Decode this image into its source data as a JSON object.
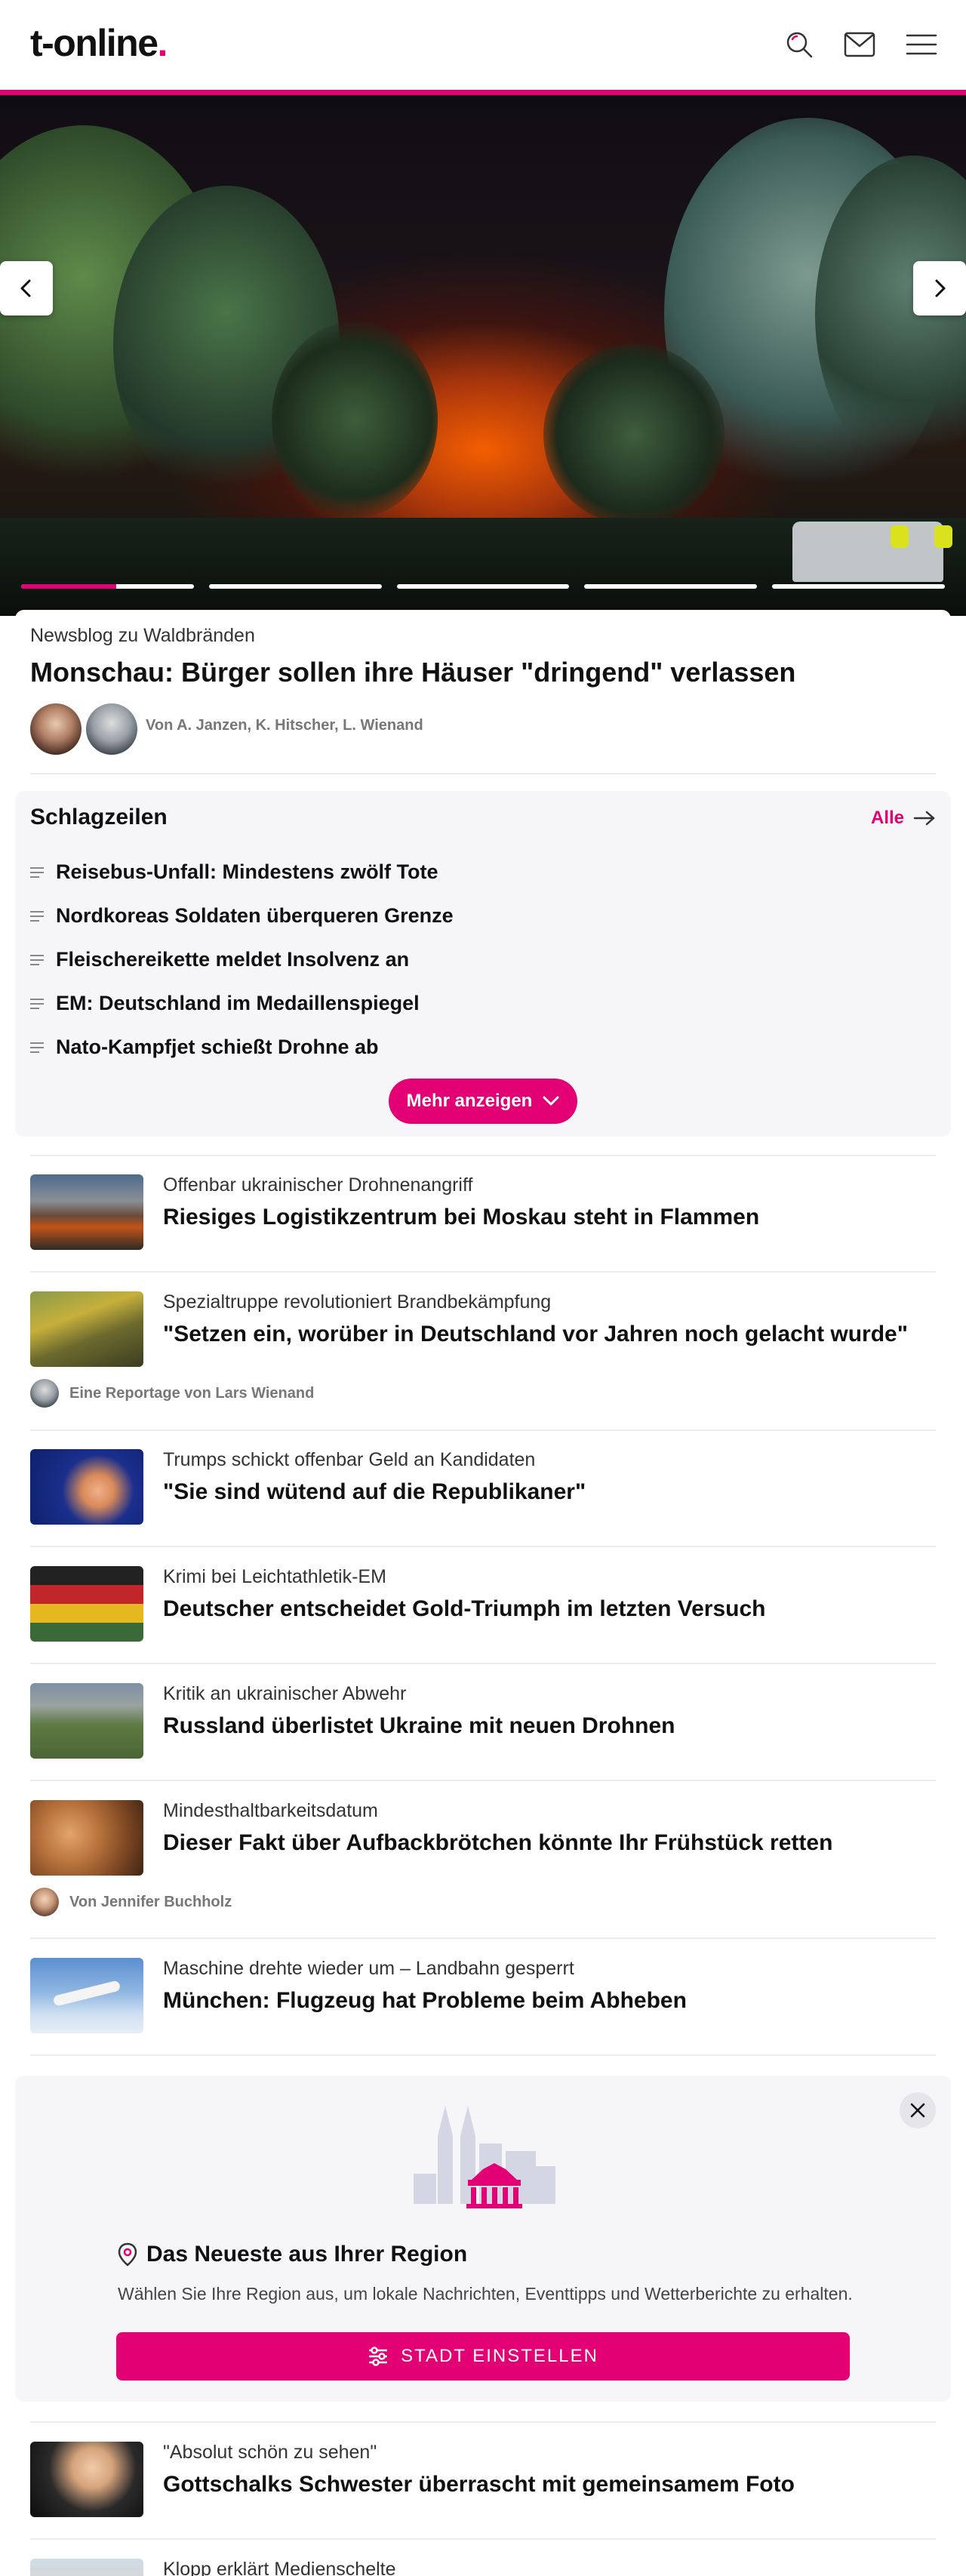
{
  "header": {
    "logo_text": "t-online",
    "logo_dot": ".",
    "brand_color": "#e20074",
    "icons": [
      "search-icon",
      "mail-icon",
      "menu-icon"
    ]
  },
  "hero": {
    "prev_icon": "chevron-left-icon",
    "next_icon": "chevron-right-icon",
    "slides_total": 5,
    "active_slide": 1,
    "active_progress": 0.55,
    "kicker": "Newsblog zu Waldbränden",
    "title": "Monschau: Bürger sollen ihre Häuser \"dringend\" verlassen",
    "authors": "Von A. Janzen, K. Hitscher, L. Wienand"
  },
  "headlines": {
    "title": "Schlagzeilen",
    "all_label": "Alle",
    "items": [
      "Reisebus-Unfall: Mindestens zwölf Tote",
      "Nordkoreas Soldaten überqueren Grenze",
      "Fleischereikette meldet Insolvenz an",
      "EM: Deutschland im Medaillenspiegel",
      "Nato-Kampfjet schießt Drohne ab"
    ],
    "more_label": "Mehr anzeigen"
  },
  "articles": [
    {
      "kicker": "Offenbar ukrainischer Drohnenangriff",
      "title": "Riesiges Logistikzentrum bei Moskau steht in Flammen",
      "author": ""
    },
    {
      "kicker": "Spezialtruppe revolutioniert Brandbekämpfung",
      "title": "\"Setzen ein, worüber in Deutschland vor Jahren noch gelacht wurde\"",
      "author": "Eine Reportage von Lars Wienand"
    },
    {
      "kicker": "Trumps schickt offenbar Geld an Kandidaten",
      "title": "\"Sie sind wütend auf die Republikaner\"",
      "author": ""
    },
    {
      "kicker": "Krimi bei Leichtathletik-EM",
      "title": "Deutscher entscheidet Gold-Triumph im letzten Versuch",
      "author": ""
    },
    {
      "kicker": "Kritik an ukrainischer Abwehr",
      "title": "Russland überlistet Ukraine mit neuen Drohnen",
      "author": ""
    },
    {
      "kicker": "Mindesthaltbarkeitsdatum",
      "title": "Dieser Fakt über Aufbackbrötchen könnte Ihr Frühstück retten",
      "author": "Von Jennifer Buchholz"
    },
    {
      "kicker": "Maschine drehte wieder um – Landbahn gesperrt",
      "title": "München: Flugzeug hat Probleme beim Abheben",
      "author": ""
    }
  ],
  "region": {
    "title": "Das Neueste aus Ihrer Region",
    "text": "Wählen Sie Ihre Region aus, um lokale Nachrichten, Eventtipps und Wetterberichte zu erhalten.",
    "button_label": "STADT EINSTELLEN"
  },
  "more_articles": [
    {
      "kicker": "\"Absolut schön zu sehen\"",
      "title": "Gottschalks Schwester überrascht mit gemeinsamem Foto"
    },
    {
      "kicker": "Klopp erklärt Medienschelte",
      "title": ""
    }
  ]
}
